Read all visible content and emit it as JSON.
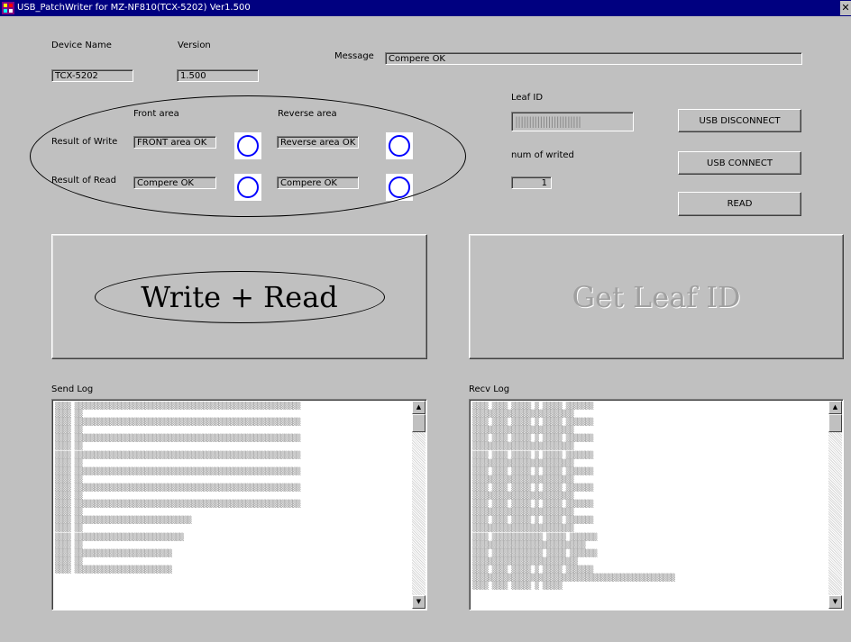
{
  "window": {
    "title": "USB_PatchWriter for MZ-NF810(TCX-5202) Ver1.500",
    "close_glyph": "✕"
  },
  "device": {
    "name_label": "Device Name",
    "name_value": "TCX-5202",
    "version_label": "Version",
    "version_value": "1.500"
  },
  "message": {
    "label": "Message",
    "value": "Compere OK"
  },
  "areas": {
    "front_label": "Front area",
    "reverse_label": "Reverse area"
  },
  "write": {
    "label": "Result of Write",
    "front_value": "FRONT area OK",
    "reverse_value": "Reverse area OK"
  },
  "read": {
    "label": "Result of Read",
    "front_value": "Compere OK",
    "reverse_value": "Compere OK"
  },
  "leaf": {
    "label": "Leaf ID",
    "value": "||||||||||||||||||||||||"
  },
  "counter": {
    "label": "num of writed",
    "value": "1"
  },
  "buttons": {
    "disconnect": "USB DISCONNECT",
    "connect": "USB CONNECT",
    "read": "READ",
    "write_read": "Write + Read",
    "get_leaf": "Get Leaf ID"
  },
  "logs": {
    "send_label": "Send Log",
    "recv_label": "Recv Log"
  },
  "colors": {
    "status_indicator": "#0000ff",
    "title_bar": "#000080"
  },
  "icons": {
    "scroll_up": "▲",
    "scroll_down": "▼"
  }
}
